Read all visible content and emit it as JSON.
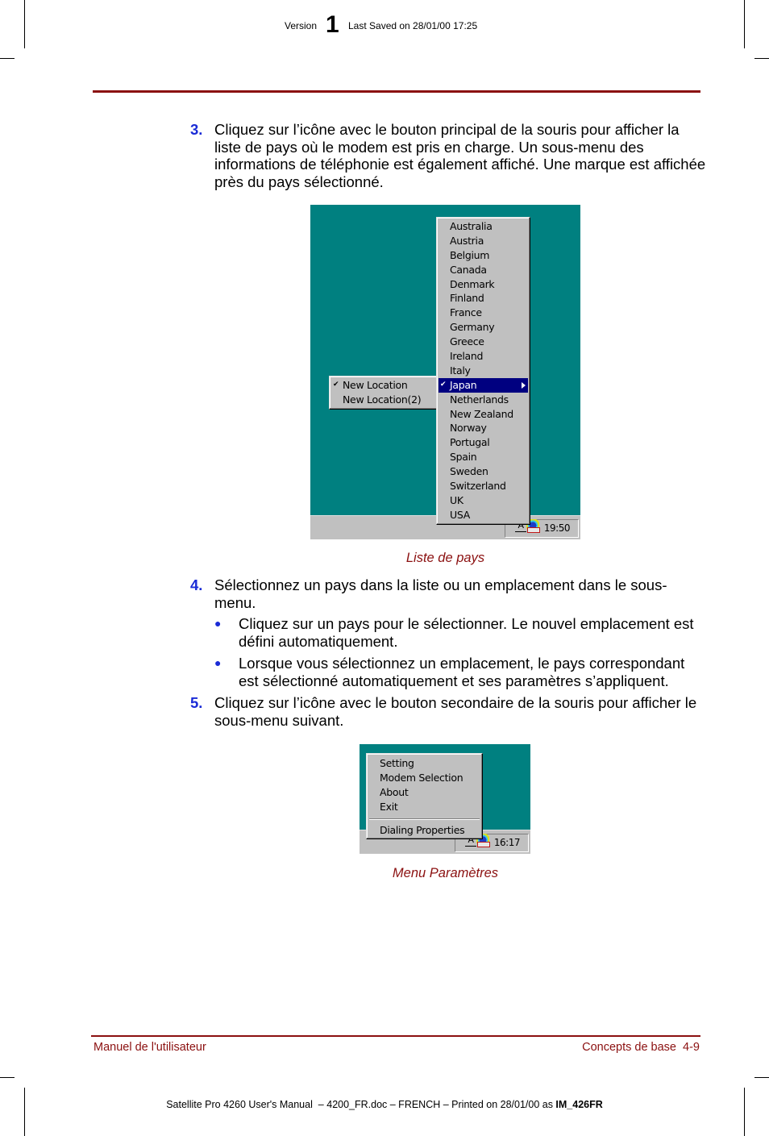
{
  "header": {
    "version_label": "Version",
    "version_number": "1",
    "last_saved": "Last Saved on 28/01/00 17:25"
  },
  "steps": [
    {
      "number": "3.",
      "text": "Cliquez sur l’icône avec le bouton principal de la souris pour afficher la liste de pays où le modem est pris en charge. Un sous-menu des informations de téléphonie est également affiché. Une marque est affichée près du pays sélectionné."
    },
    {
      "number": "4.",
      "text": "Sélectionnez un pays dans la liste ou un emplacement dans le sous-menu.",
      "bullets": [
        "Cliquez sur un pays pour le sélectionner. Le nouvel emplacement est défini automatiquement.",
        "Lorsque vous sélectionnez un emplacement, le pays correspondant est sélectionné automatiquement et ses paramètres s’appliquent."
      ]
    },
    {
      "number": "5.",
      "text": "Cliquez sur l’icône avec le bouton secondaire de la souris pour afficher le sous-menu suivant."
    }
  ],
  "figure1": {
    "caption": "Liste de pays",
    "countries": [
      "Australia",
      "Austria",
      "Belgium",
      "Canada",
      "Denmark",
      "Finland",
      "France",
      "Germany",
      "Greece",
      "Ireland",
      "Italy",
      "Japan",
      "Netherlands",
      "New Zealand",
      "Norway",
      "Portugal",
      "Spain",
      "Sweden",
      "Switzerland",
      "UK",
      "USA"
    ],
    "selected_country": "Japan",
    "locations": [
      "New Location",
      "New Location(2)"
    ],
    "checked_location": "New Location",
    "check_glyph": "✔",
    "clock": "19:50",
    "modem_glyph": "A"
  },
  "figure2": {
    "caption": "Menu Paramètres",
    "menu_items": [
      "Setting",
      "Modem Selection",
      "About",
      "Exit"
    ],
    "menu_items_after_separator": [
      "Dialing Properties"
    ],
    "clock": "16:17",
    "modem_glyph": "A"
  },
  "footer": {
    "left": "Manuel de l'utilisateur",
    "right": "Concepts de base  4-9",
    "print_line": "Satellite Pro 4260 User's Manual  – 4200_FR.doc – FRENCH – Printed on 28/01/00 as ",
    "print_id": "IM_426FR"
  },
  "colors": {
    "accent_red": "#8b1010",
    "step_number_blue": "#1a2bd6",
    "desktop_teal": "#008080",
    "menu_gray": "#c0c0c0",
    "selection_navy": "#000080"
  }
}
